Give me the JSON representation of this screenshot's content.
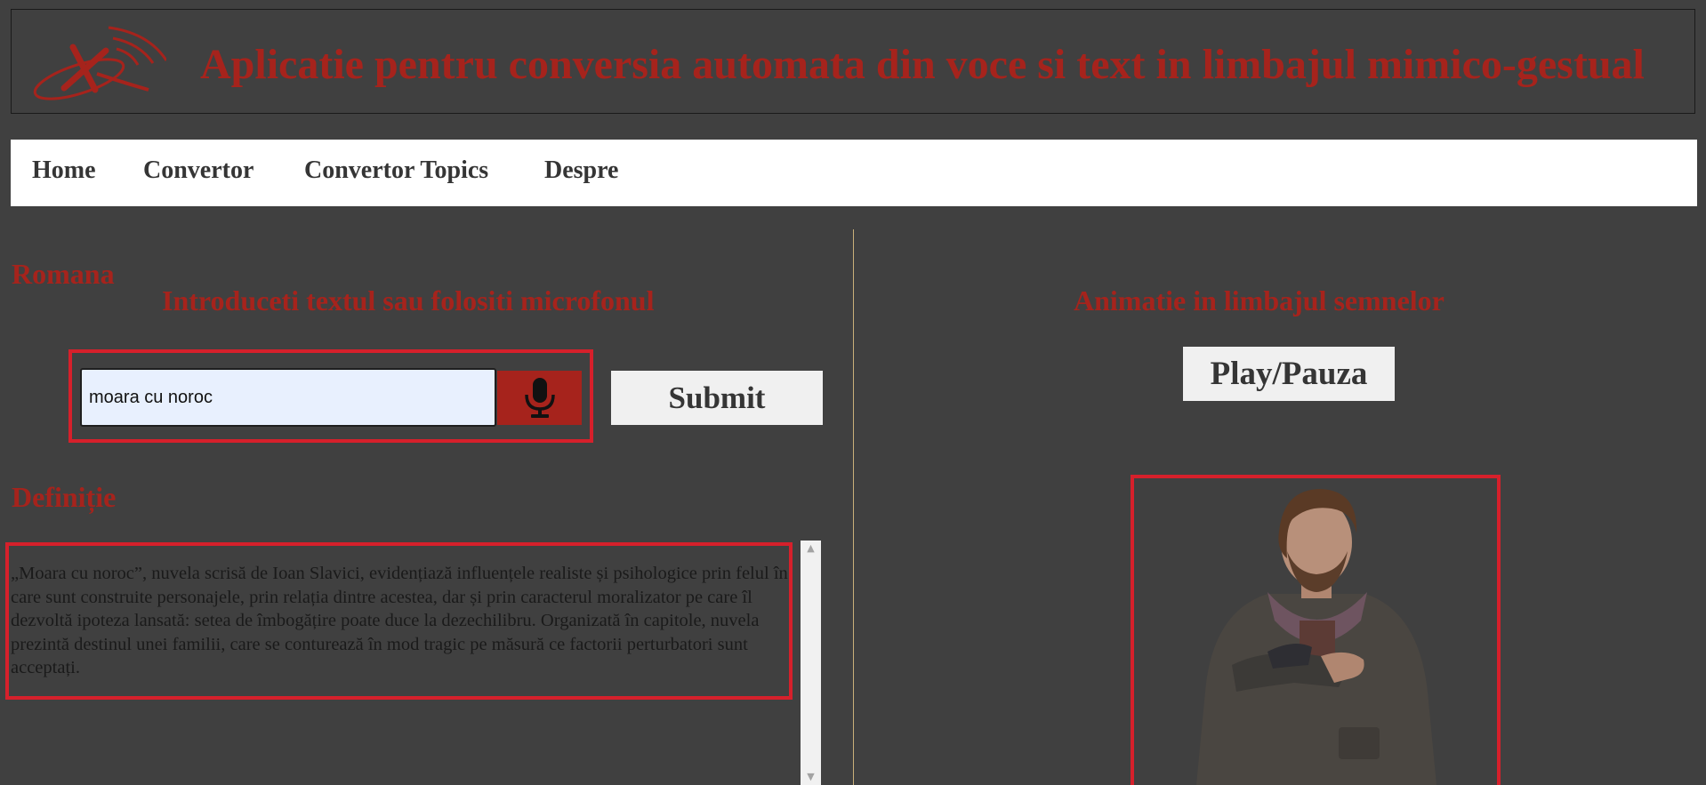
{
  "header": {
    "title": "Aplicatie pentru conversia automata din voce si text in limbajul mimico-gestual",
    "logo_icon": "logo-icon"
  },
  "nav": {
    "items": [
      {
        "label": "Home"
      },
      {
        "label": "Convertor"
      },
      {
        "label": "Convertor Topics"
      },
      {
        "label": "Despre"
      }
    ]
  },
  "left": {
    "language_label": "Romana",
    "instruction": "Introduceti textul sau folositi microfonul",
    "input_value": "moara cu noroc",
    "mic_icon": "microphone-icon",
    "submit_label": "Submit",
    "definition_heading": "Definiție",
    "definition_text": "„Moara cu noroc”, nuvela scrisă de Ioan Slavici, evidențiază influențele realiste și psihologice prin felul în care sunt construite personajele, prin relația dintre acestea, dar și prin caracterul moralizator pe care îl dezvoltă ipoteza lansată: setea de îmbogățire poate duce la dezechilibru. Organizată în capitole, nuvela prezintă destinul unei familii, care se conturează în mod tragic pe măsură ce factorii perturbatori sunt acceptați."
  },
  "right": {
    "heading": "Animatie in limbajul semnelor",
    "play_label": "Play/Pauza"
  },
  "colors": {
    "accent": "#a6231c",
    "highlight_border": "#d6202b",
    "background": "#404040"
  }
}
